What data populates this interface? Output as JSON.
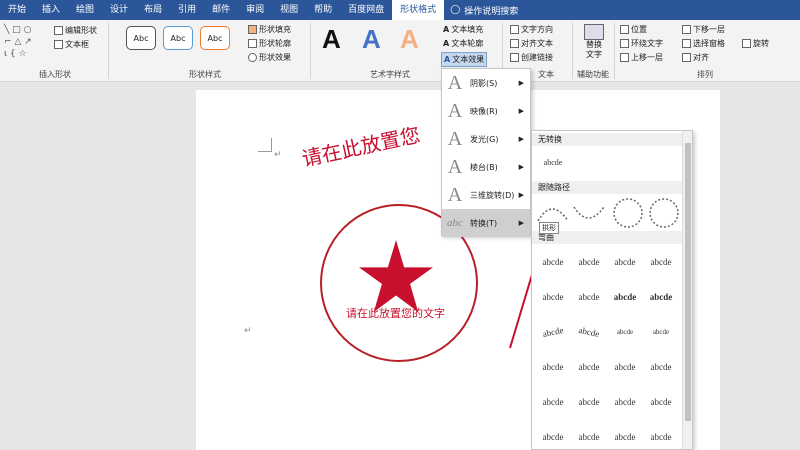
{
  "tabs": [
    "开始",
    "插入",
    "绘图",
    "设计",
    "布局",
    "引用",
    "邮件",
    "审阅",
    "视图",
    "帮助",
    "百度网盘",
    "形状格式"
  ],
  "active_tab": "形状格式",
  "tell_me": "操作说明搜索",
  "ribbon": {
    "insert_shapes": {
      "edit_shape": "编辑形状",
      "text_box": "文本框",
      "label": "插入形状"
    },
    "shape_styles": {
      "sample": "Abc",
      "fill": "形状填充",
      "outline": "形状轮廓",
      "effects": "形状效果",
      "label": "形状样式"
    },
    "wordart": {
      "sample": "A",
      "text_fill": "文本填充",
      "text_outline": "文本轮廓",
      "text_effects": "文本效果",
      "label": "艺术字样式"
    },
    "text": {
      "direction": "文字方向",
      "align": "对齐文本",
      "link": "创建链接",
      "label": "文本"
    },
    "accessibility": {
      "alt_text": "替换文字",
      "label": "辅助功能"
    },
    "arrange": {
      "position": "位置",
      "wrap": "环绕文字",
      "forward": "上移一层",
      "backward": "下移一层",
      "pane": "选择窗格",
      "align": "对齐",
      "rotate": "旋转",
      "label": "排列"
    }
  },
  "document": {
    "arc_text": "请在此放置您",
    "stamp_text": "请在此放置您的文字"
  },
  "text_effects_menu": {
    "items": [
      {
        "label": "阴影(S)"
      },
      {
        "label": "映像(R)"
      },
      {
        "label": "发光(G)"
      },
      {
        "label": "棱台(B)"
      },
      {
        "label": "三维旋转(D)"
      },
      {
        "label": "转换(T)"
      }
    ]
  },
  "transform_submenu": {
    "no_transform": "无转换",
    "sample": "abcde",
    "follow_path": "跟随路径",
    "warp": "弯曲",
    "tooltip": "拱形",
    "warp_cells": [
      "abcde",
      "abcde",
      "abcde",
      "abcde",
      "abcde",
      "abcde",
      "abcde",
      "abcde",
      "abcde",
      "abcde",
      "abcde",
      "abcde",
      "abcde",
      "abcde",
      "abcde",
      "abcde",
      "abcde",
      "abcde",
      "abcde",
      "abcde",
      "abcde",
      "abcde",
      "abcde",
      "abcde"
    ]
  }
}
